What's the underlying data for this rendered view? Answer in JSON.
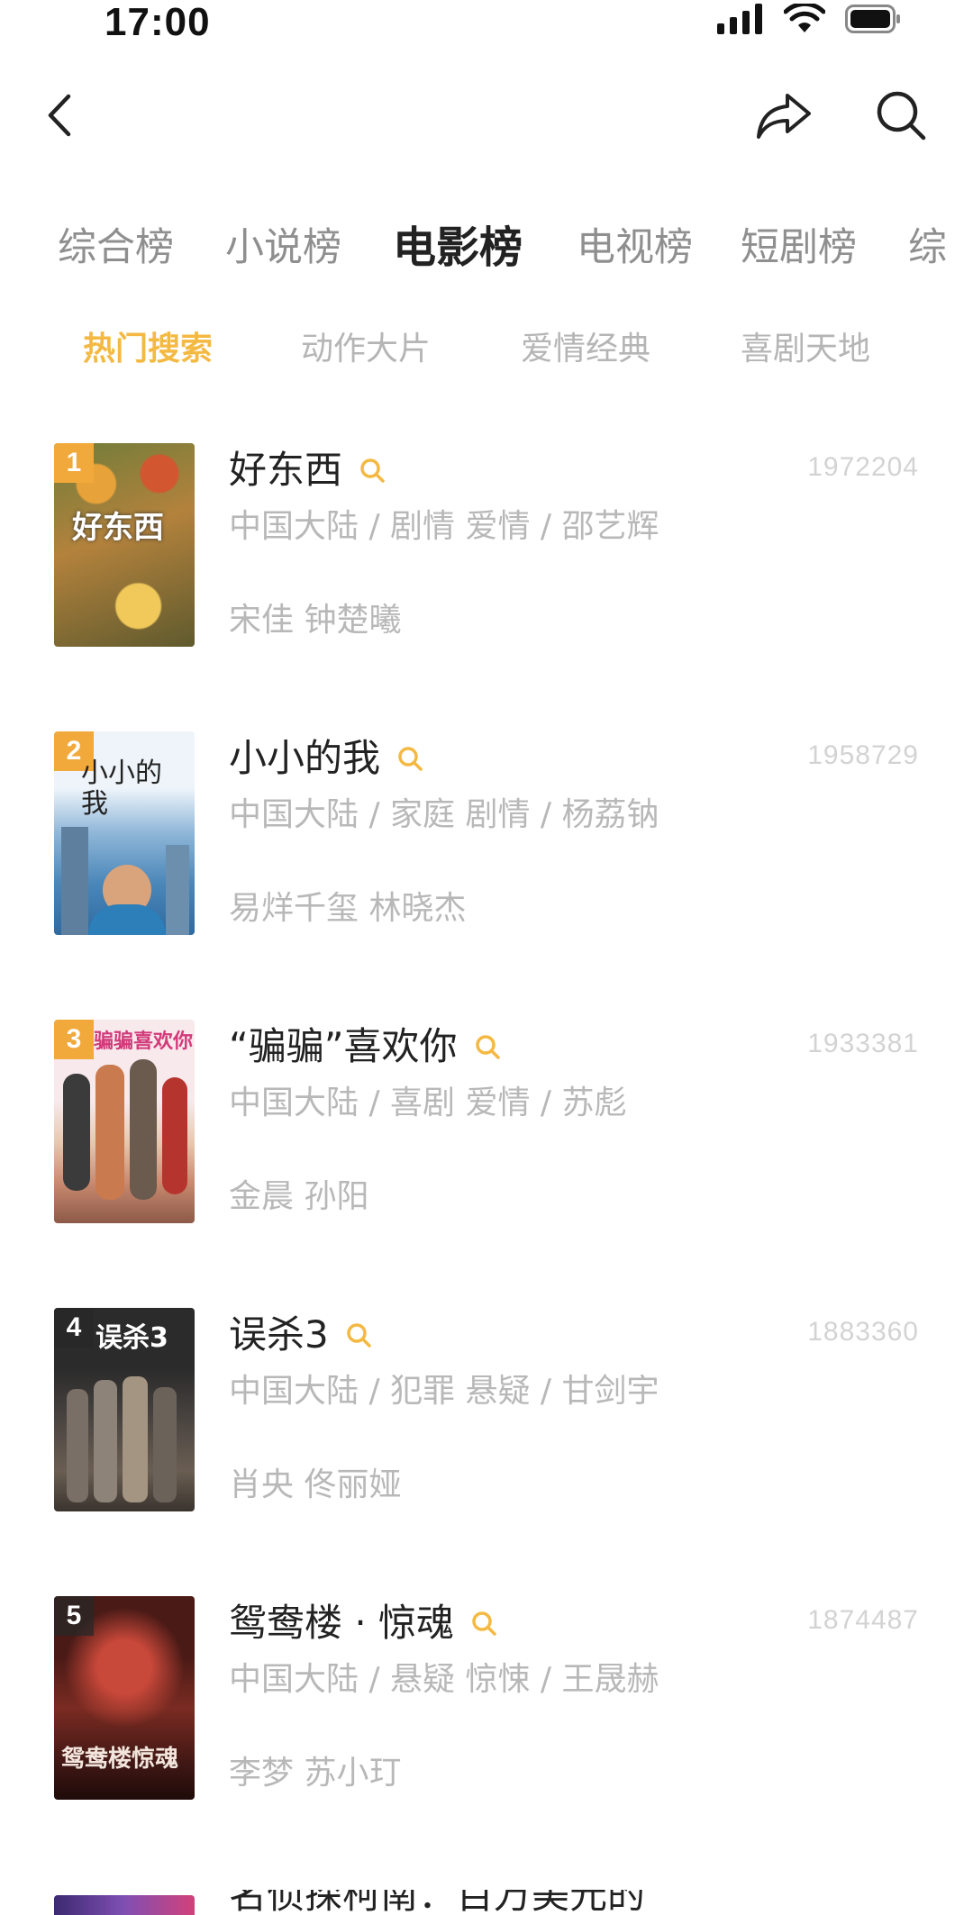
{
  "status_bar": {
    "time": "17:00"
  },
  "nav": {
    "back_icon": "chevron-left-icon",
    "share_icon": "share-arrow-icon",
    "search_icon": "search-icon"
  },
  "category_tabs": [
    {
      "label": "综合榜",
      "active": false
    },
    {
      "label": "小说榜",
      "active": false
    },
    {
      "label": "电影榜",
      "active": true
    },
    {
      "label": "电视榜",
      "active": false
    },
    {
      "label": "短剧榜",
      "active": false
    },
    {
      "label": "综",
      "active": false
    }
  ],
  "sub_tabs": [
    {
      "label": "热门搜索",
      "active": true
    },
    {
      "label": "动作大片",
      "active": false
    },
    {
      "label": "爱情经典",
      "active": false
    },
    {
      "label": "喜剧天地",
      "active": false
    }
  ],
  "colors": {
    "accent": "#f4b942",
    "badge_top": "#f2a93b",
    "text_primary": "#222222",
    "text_secondary": "#b8b8b8",
    "score": "#d3d3d3"
  },
  "items": [
    {
      "rank": "1",
      "title": "好东西",
      "score": "1972204",
      "meta": "中国大陆 / 剧情 爱情 / 邵艺辉",
      "cast": "宋佳 钟楚曦",
      "poster_text": "好东西"
    },
    {
      "rank": "2",
      "title": "小小的我",
      "score": "1958729",
      "meta": "中国大陆 / 家庭 剧情 / 杨荔钠",
      "cast": "易烊千玺 林晓杰",
      "poster_text": "小小的我"
    },
    {
      "rank": "3",
      "title": "“骗骗”喜欢你",
      "score": "1933381",
      "meta": "中国大陆 / 喜剧 爱情 / 苏彪",
      "cast": "金晨 孙阳",
      "poster_text": "骗骗喜欢你"
    },
    {
      "rank": "4",
      "title": "误杀3",
      "score": "1883360",
      "meta": "中国大陆 / 犯罪 悬疑 / 甘剑宇",
      "cast": "肖央 佟丽娅",
      "poster_text": "误杀3"
    },
    {
      "rank": "5",
      "title": "鸳鸯楼 · 惊魂",
      "score": "1874487",
      "meta": "中国大陆 / 悬疑 惊悚 / 王晟赫",
      "cast": "李梦 苏小玎",
      "poster_text": "鸳鸯楼惊魂"
    }
  ],
  "next_item_peek": {
    "title": "名侦探柯南：百万美元的"
  }
}
